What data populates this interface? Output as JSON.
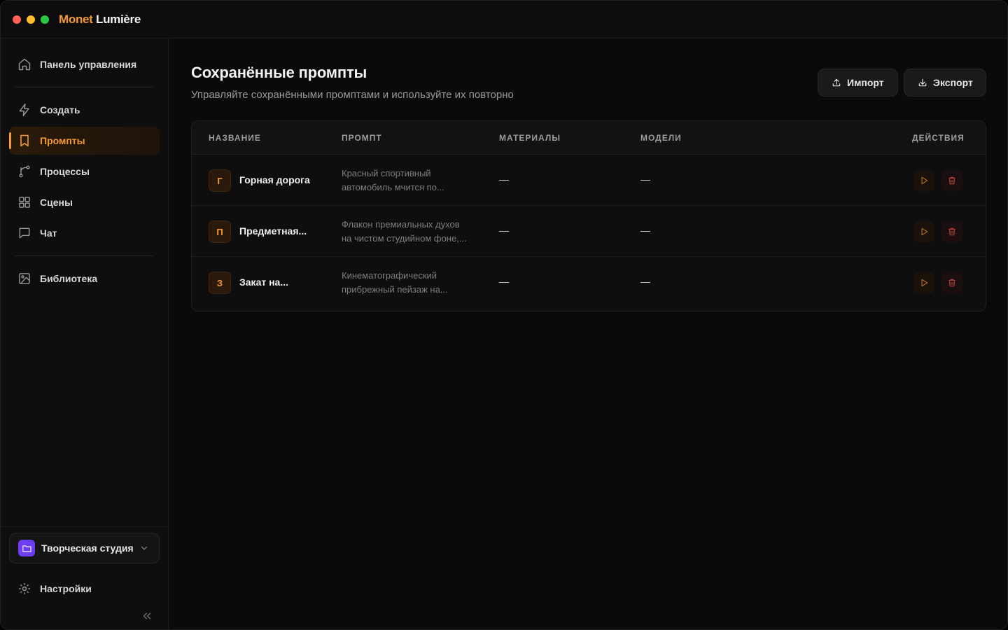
{
  "app": {
    "brand_part1": "Monet",
    "brand_part2": "Lumière",
    "accent_color": "#f59a2f"
  },
  "sidebar": {
    "items": [
      {
        "label": "Панель управления",
        "icon": "home-icon"
      },
      {
        "label": "Создать",
        "icon": "lightning-icon"
      },
      {
        "label": "Промпты",
        "icon": "bookmark-icon",
        "active": true
      },
      {
        "label": "Процессы",
        "icon": "workflow-icon"
      },
      {
        "label": "Сцены",
        "icon": "grid-icon"
      },
      {
        "label": "Чат",
        "icon": "chat-icon"
      },
      {
        "label": "Библиотека",
        "icon": "image-icon"
      }
    ],
    "workspace": {
      "label": "Творческая студия",
      "icon": "folder-icon"
    },
    "settings_label": "Настройки"
  },
  "main": {
    "title": "Сохранённые промпты",
    "subtitle": "Управляйте сохранёнными промптами и используйте их повторно",
    "import_label": "Импорт",
    "export_label": "Экспорт",
    "table": {
      "headers": {
        "name": "НАЗВАНИЕ",
        "prompt": "ПРОМПТ",
        "materials": "МАТЕРИАЛЫ",
        "models": "МОДЕЛИ",
        "actions": "ДЕЙСТВИЯ"
      },
      "rows": [
        {
          "initial": "Г",
          "name": "Горная дорога",
          "prompt": "Красный спортивный автомобиль мчится по...",
          "materials": "—",
          "models": "—"
        },
        {
          "initial": "П",
          "name": "Предметная...",
          "prompt": "Флакон премиальных духов на чистом студийном фоне,...",
          "materials": "—",
          "models": "—"
        },
        {
          "initial": "З",
          "name": "Закат на...",
          "prompt": "Кинематографический прибрежный пейзаж на...",
          "materials": "—",
          "models": "—"
        }
      ]
    }
  }
}
